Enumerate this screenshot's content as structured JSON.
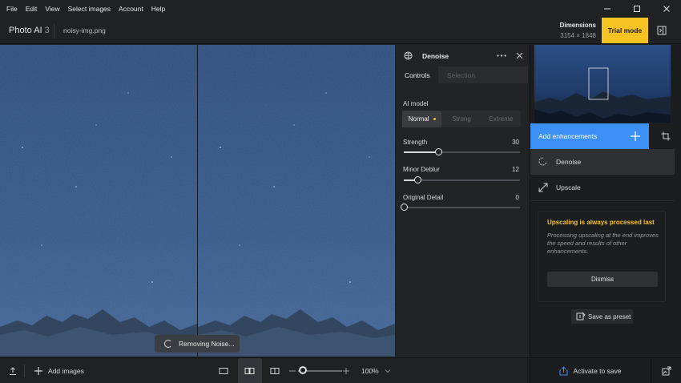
{
  "menu": [
    "File",
    "Edit",
    "View",
    "Select images",
    "Account",
    "Help"
  ],
  "window_controls": {
    "minimize": "—",
    "maximize": "☐",
    "close": "✕"
  },
  "title": {
    "app_name": "Photo AI",
    "version": "3",
    "filename": "noisy-img.png"
  },
  "dimensions": {
    "label": "Dimensions",
    "value": "3154 × 1848"
  },
  "trial_button": "Trial mode",
  "toast": "Removing Noise...",
  "bottom": {
    "add_images": "Add images",
    "zoom": "100%",
    "zoom_fraction": 0.1
  },
  "controls": {
    "title": "Denoise",
    "tabs": [
      "Controls",
      "Selection"
    ],
    "ai_model_label": "AI model",
    "models": [
      "Normal",
      "Strong",
      "Extreme"
    ],
    "selected_model": "Normal",
    "sliders": [
      {
        "label": "Strength",
        "value": "30",
        "fraction": 0.3
      },
      {
        "label": "Minor Deblur",
        "value": "12",
        "fraction": 0.12
      },
      {
        "label": "Original Detail",
        "value": "0",
        "fraction": 0.0
      }
    ]
  },
  "right": {
    "add_enhancements": "Add enhancements",
    "enhancements": [
      "Denoise",
      "Upscale"
    ],
    "notice_title": "Upscaling is always processed last",
    "notice_body": "Processing upscaling at the end improves the speed and results of other enhancements.",
    "dismiss": "Dismiss",
    "save_preset": "Save as preset",
    "activate": "Activate to save"
  },
  "colors": {
    "accent_blue": "#3b8ff5",
    "accent_yellow": "#f6c323",
    "panel": "#222325"
  }
}
